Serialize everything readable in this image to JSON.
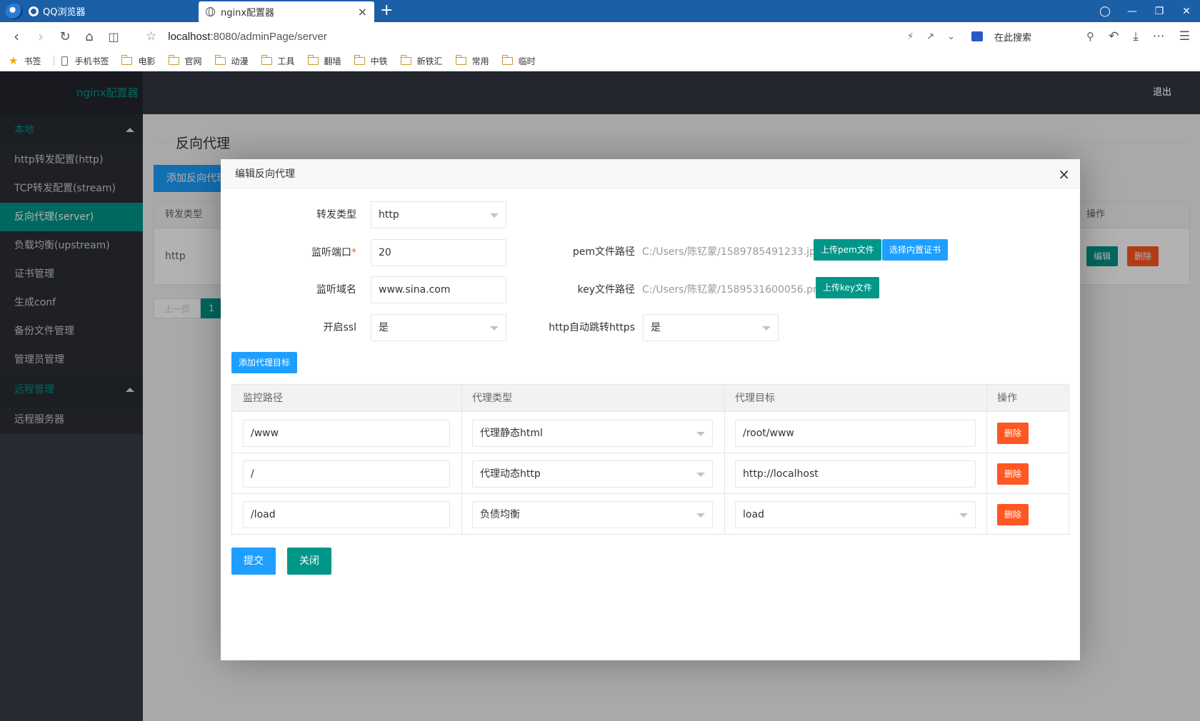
{
  "browser": {
    "app_tab": "QQ浏览器",
    "active_tab": "nginx配置器",
    "tab_close": "×",
    "new_tab": "+",
    "url_host": "localhost",
    "url_rest": ":8080/adminPage/server",
    "search_placeholder": "在此搜索",
    "bookmarks": [
      "书签",
      "手机书签",
      "电影",
      "官网",
      "动漫",
      "工具",
      "翻墙",
      "中铁",
      "新铁汇",
      "常用",
      "临时"
    ]
  },
  "app": {
    "logo": "nginx配置器",
    "logout": "退出"
  },
  "sidebar": {
    "groups": [
      {
        "label": "本地",
        "items": [
          "http转发配置(http)",
          "TCP转发配置(stream)",
          "反向代理(server)",
          "负载均衡(upstream)",
          "证书管理",
          "生成conf",
          "备份文件管理",
          "管理员管理"
        ]
      },
      {
        "label": "远程管理",
        "items": [
          "远程服务器"
        ]
      }
    ],
    "active_item": "反向代理(server)"
  },
  "page": {
    "title": "反向代理",
    "add_button": "添加反向代理",
    "table_headers": [
      "转发类型",
      "操作"
    ],
    "row_type": "http",
    "edit": "编辑",
    "delete": "删除",
    "prev": "上一页",
    "page": "1"
  },
  "modal": {
    "title": "编辑反向代理",
    "close": "×",
    "fields": {
      "type_label": "转发类型",
      "type_value": "http",
      "port_label": "监听端口",
      "port_required": "*",
      "port_value": "20",
      "domain_label": "监听域名",
      "domain_value": "www.sina.com",
      "ssl_label": "开启ssl",
      "ssl_value": "是",
      "pem_label": "pem文件路径",
      "pem_value": "C:/Users/陈钇蒙/1589785491233.jpg",
      "upload_pem": "上传pem文件",
      "choose_cert": "选择内置证书",
      "key_label": "key文件路径",
      "key_value": "C:/Users/陈钇蒙/1589531600056.png",
      "upload_key": "上传key文件",
      "redirect_label": "http自动跳转https",
      "redirect_value": "是"
    },
    "add_target": "添加代理目标",
    "proxy_table": {
      "headers": [
        "监控路径",
        "代理类型",
        "代理目标",
        "操作"
      ],
      "rows": [
        {
          "path": "/www",
          "type": "代理静态html",
          "target": "/root/www",
          "action": "删除"
        },
        {
          "path": "/",
          "type": "代理动态http",
          "target": "http://localhost",
          "action": "删除"
        },
        {
          "path": "/load",
          "type": "负债均衡",
          "target": "load",
          "action": "删除"
        }
      ]
    },
    "submit": "提交",
    "close_btn": "关闭"
  },
  "colors": {
    "teal": "#009688",
    "blue": "#1e9fff",
    "red": "#ff5722",
    "header_dark": "#23262e",
    "browser_blue": "#1b5fa7"
  }
}
